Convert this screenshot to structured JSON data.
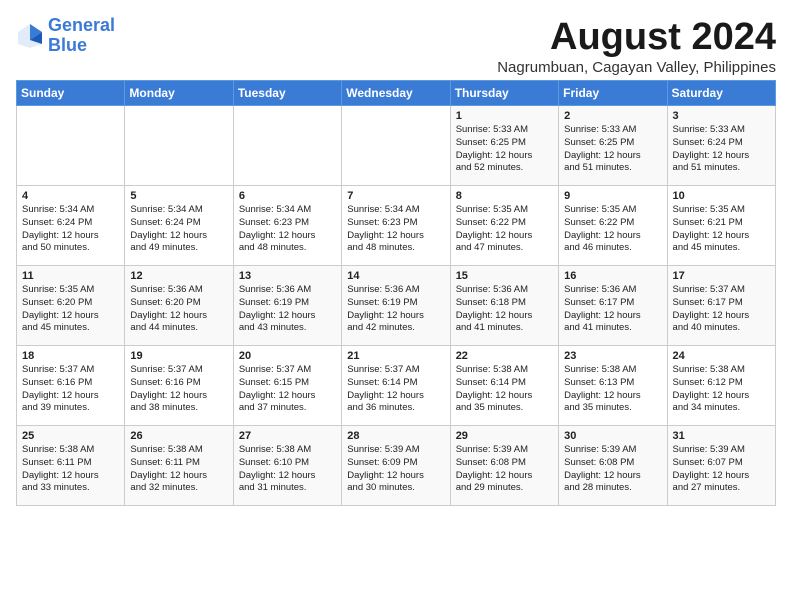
{
  "logo": {
    "line1": "General",
    "line2": "Blue"
  },
  "title": "August 2024",
  "location": "Nagrumbuan, Cagayan Valley, Philippines",
  "days_of_week": [
    "Sunday",
    "Monday",
    "Tuesday",
    "Wednesday",
    "Thursday",
    "Friday",
    "Saturday"
  ],
  "weeks": [
    [
      {
        "day": "",
        "text": ""
      },
      {
        "day": "",
        "text": ""
      },
      {
        "day": "",
        "text": ""
      },
      {
        "day": "",
        "text": ""
      },
      {
        "day": "1",
        "text": "Sunrise: 5:33 AM\nSunset: 6:25 PM\nDaylight: 12 hours\nand 52 minutes."
      },
      {
        "day": "2",
        "text": "Sunrise: 5:33 AM\nSunset: 6:25 PM\nDaylight: 12 hours\nand 51 minutes."
      },
      {
        "day": "3",
        "text": "Sunrise: 5:33 AM\nSunset: 6:24 PM\nDaylight: 12 hours\nand 51 minutes."
      }
    ],
    [
      {
        "day": "4",
        "text": "Sunrise: 5:34 AM\nSunset: 6:24 PM\nDaylight: 12 hours\nand 50 minutes."
      },
      {
        "day": "5",
        "text": "Sunrise: 5:34 AM\nSunset: 6:24 PM\nDaylight: 12 hours\nand 49 minutes."
      },
      {
        "day": "6",
        "text": "Sunrise: 5:34 AM\nSunset: 6:23 PM\nDaylight: 12 hours\nand 48 minutes."
      },
      {
        "day": "7",
        "text": "Sunrise: 5:34 AM\nSunset: 6:23 PM\nDaylight: 12 hours\nand 48 minutes."
      },
      {
        "day": "8",
        "text": "Sunrise: 5:35 AM\nSunset: 6:22 PM\nDaylight: 12 hours\nand 47 minutes."
      },
      {
        "day": "9",
        "text": "Sunrise: 5:35 AM\nSunset: 6:22 PM\nDaylight: 12 hours\nand 46 minutes."
      },
      {
        "day": "10",
        "text": "Sunrise: 5:35 AM\nSunset: 6:21 PM\nDaylight: 12 hours\nand 45 minutes."
      }
    ],
    [
      {
        "day": "11",
        "text": "Sunrise: 5:35 AM\nSunset: 6:20 PM\nDaylight: 12 hours\nand 45 minutes."
      },
      {
        "day": "12",
        "text": "Sunrise: 5:36 AM\nSunset: 6:20 PM\nDaylight: 12 hours\nand 44 minutes."
      },
      {
        "day": "13",
        "text": "Sunrise: 5:36 AM\nSunset: 6:19 PM\nDaylight: 12 hours\nand 43 minutes."
      },
      {
        "day": "14",
        "text": "Sunrise: 5:36 AM\nSunset: 6:19 PM\nDaylight: 12 hours\nand 42 minutes."
      },
      {
        "day": "15",
        "text": "Sunrise: 5:36 AM\nSunset: 6:18 PM\nDaylight: 12 hours\nand 41 minutes."
      },
      {
        "day": "16",
        "text": "Sunrise: 5:36 AM\nSunset: 6:17 PM\nDaylight: 12 hours\nand 41 minutes."
      },
      {
        "day": "17",
        "text": "Sunrise: 5:37 AM\nSunset: 6:17 PM\nDaylight: 12 hours\nand 40 minutes."
      }
    ],
    [
      {
        "day": "18",
        "text": "Sunrise: 5:37 AM\nSunset: 6:16 PM\nDaylight: 12 hours\nand 39 minutes."
      },
      {
        "day": "19",
        "text": "Sunrise: 5:37 AM\nSunset: 6:16 PM\nDaylight: 12 hours\nand 38 minutes."
      },
      {
        "day": "20",
        "text": "Sunrise: 5:37 AM\nSunset: 6:15 PM\nDaylight: 12 hours\nand 37 minutes."
      },
      {
        "day": "21",
        "text": "Sunrise: 5:37 AM\nSunset: 6:14 PM\nDaylight: 12 hours\nand 36 minutes."
      },
      {
        "day": "22",
        "text": "Sunrise: 5:38 AM\nSunset: 6:14 PM\nDaylight: 12 hours\nand 35 minutes."
      },
      {
        "day": "23",
        "text": "Sunrise: 5:38 AM\nSunset: 6:13 PM\nDaylight: 12 hours\nand 35 minutes."
      },
      {
        "day": "24",
        "text": "Sunrise: 5:38 AM\nSunset: 6:12 PM\nDaylight: 12 hours\nand 34 minutes."
      }
    ],
    [
      {
        "day": "25",
        "text": "Sunrise: 5:38 AM\nSunset: 6:11 PM\nDaylight: 12 hours\nand 33 minutes."
      },
      {
        "day": "26",
        "text": "Sunrise: 5:38 AM\nSunset: 6:11 PM\nDaylight: 12 hours\nand 32 minutes."
      },
      {
        "day": "27",
        "text": "Sunrise: 5:38 AM\nSunset: 6:10 PM\nDaylight: 12 hours\nand 31 minutes."
      },
      {
        "day": "28",
        "text": "Sunrise: 5:39 AM\nSunset: 6:09 PM\nDaylight: 12 hours\nand 30 minutes."
      },
      {
        "day": "29",
        "text": "Sunrise: 5:39 AM\nSunset: 6:08 PM\nDaylight: 12 hours\nand 29 minutes."
      },
      {
        "day": "30",
        "text": "Sunrise: 5:39 AM\nSunset: 6:08 PM\nDaylight: 12 hours\nand 28 minutes."
      },
      {
        "day": "31",
        "text": "Sunrise: 5:39 AM\nSunset: 6:07 PM\nDaylight: 12 hours\nand 27 minutes."
      }
    ]
  ]
}
